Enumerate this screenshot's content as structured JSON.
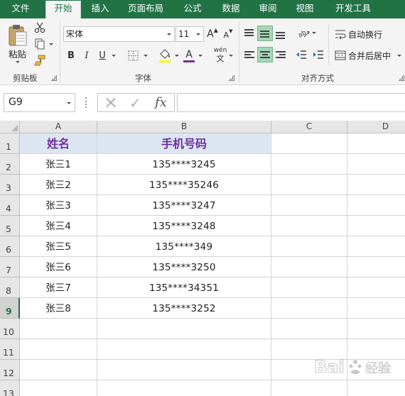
{
  "tabs": [
    {
      "label": "文件"
    },
    {
      "label": "开始"
    },
    {
      "label": "插入"
    },
    {
      "label": "页面布局"
    },
    {
      "label": "公式"
    },
    {
      "label": "数据"
    },
    {
      "label": "审阅"
    },
    {
      "label": "视图"
    },
    {
      "label": "开发工具"
    }
  ],
  "ribbon": {
    "clipboard": {
      "paste_label": "粘贴",
      "group_label": "剪贴板"
    },
    "font": {
      "font_name": "宋体",
      "font_size": "11",
      "grow_label": "A",
      "shrink_label": "A",
      "bold_label": "B",
      "italic_label": "I",
      "underline_label": "U",
      "font_color_label": "A",
      "phonetic_label": "wén",
      "phonetic_sub": "文",
      "group_label": "字体"
    },
    "alignment": {
      "wrap_text_label": "自动换行",
      "merge_center_label": "合并后居中",
      "group_label": "对齐方式"
    }
  },
  "formula_bar": {
    "name_box": "G9",
    "cancel_icon": "×",
    "enter_icon": "✓",
    "fx_label": "fx",
    "value": ""
  },
  "sheet": {
    "columns": [
      "A",
      "B",
      "C",
      "D"
    ],
    "rows": [
      "1",
      "2",
      "3",
      "4",
      "5",
      "6",
      "7",
      "8",
      "9",
      "10",
      "11",
      "12",
      "13"
    ],
    "header": {
      "name": "姓名",
      "phone": "手机号码"
    },
    "data": [
      {
        "name": "张三1",
        "phone": "135****3245"
      },
      {
        "name": "张三2",
        "phone": "135****35246"
      },
      {
        "name": "张三3",
        "phone": "135****3247"
      },
      {
        "name": "张三4",
        "phone": "135****3248"
      },
      {
        "name": "张三5",
        "phone": "135****349"
      },
      {
        "name": "张三6",
        "phone": "135****3250"
      },
      {
        "name": "张三7",
        "phone": "135****34351"
      },
      {
        "name": "张三8",
        "phone": "135****3252"
      }
    ],
    "selected_row": "9"
  },
  "watermark": {
    "text": "Bai 经验"
  },
  "colors": {
    "excel_green": "#217346",
    "header_fill": "#dce6f1",
    "header_text": "#7030a0",
    "align_selected": "#a5d6b6"
  }
}
